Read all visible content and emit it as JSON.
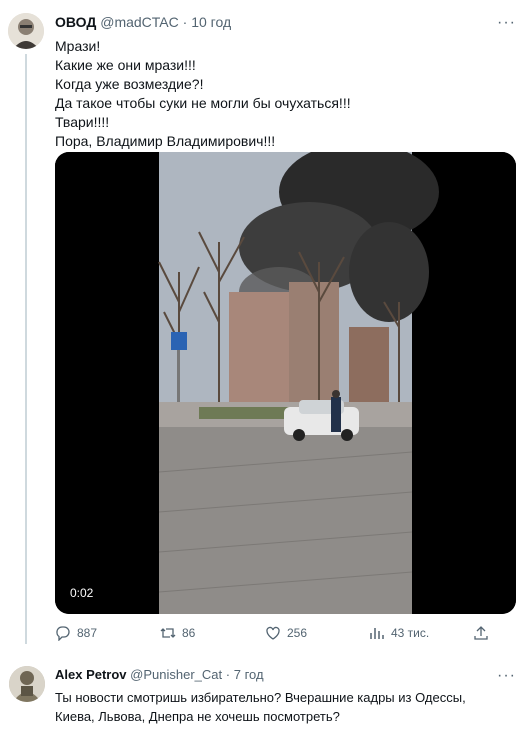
{
  "tweet1": {
    "author_name": "ОВОД",
    "handle": "@madCTAC",
    "separator": "·",
    "time": "10 год",
    "lines": [
      "Мрази!",
      "Какие же они мрази!!!",
      "Когда уже возмездие?!",
      "Да такое чтобы суки не могли бы очухаться!!!",
      "Твари!!!!",
      "Пора, Владимир Владимирович!!!"
    ],
    "video_timestamp": "0:02",
    "actions": {
      "replies": "887",
      "retweets": "86",
      "likes": "256",
      "views": "43 тис."
    }
  },
  "tweet2": {
    "author_name": "Alex Petrov",
    "handle": "@Punisher_Cat",
    "separator": "·",
    "time": "7 год",
    "lines": [
      "Ты новости смотришь избирательно? Вчерашние кадры из Одессы,",
      "Киева, Львова, Днепра не хочешь посмотреть?"
    ]
  },
  "icons": {
    "more": "more-horizontal-icon",
    "reply": "reply-icon",
    "retweet": "retweet-icon",
    "like": "heart-icon",
    "views": "views-chart-icon",
    "share": "share-icon"
  },
  "colors": {
    "muted": "#536471",
    "divider": "#cfd9de"
  }
}
